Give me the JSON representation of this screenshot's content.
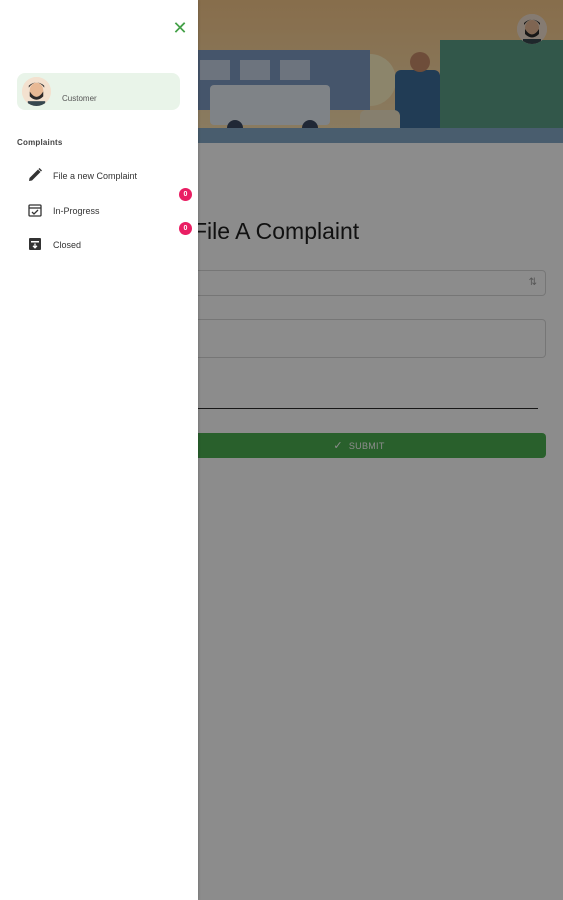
{
  "page": {
    "title": "File A Complaint",
    "submit_label": "SUBMIT",
    "select_arrow": "⇅"
  },
  "drawer": {
    "close_glyph": "✕",
    "profile": {
      "role": "Customer"
    },
    "section_title": "Complaints",
    "items": [
      {
        "label": "File a new Complaint",
        "icon": "pencil-icon"
      },
      {
        "label": "In-Progress",
        "icon": "calendar-check-icon",
        "badge": "0"
      },
      {
        "label": "Closed",
        "icon": "archive-box-icon",
        "badge": "0"
      }
    ]
  },
  "colors": {
    "accent": "#4caf50",
    "close": "#43a047",
    "badge": "#e91e63",
    "profile_card": "#e9f4e9"
  }
}
